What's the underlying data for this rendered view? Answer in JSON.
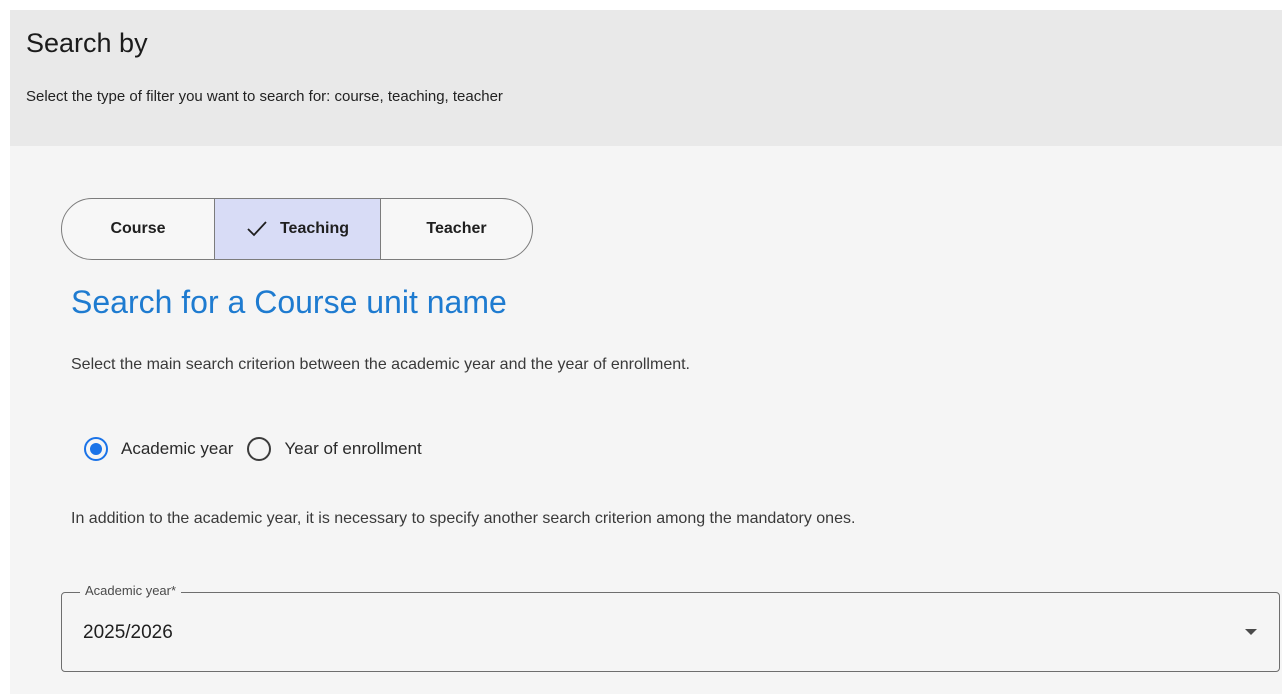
{
  "header": {
    "title": "Search by",
    "subtitle": "Select the type of filter you want to search for: course, teaching, teacher"
  },
  "filter_tabs": {
    "items": [
      {
        "label": "Course",
        "selected": false
      },
      {
        "label": "Teaching",
        "selected": true
      },
      {
        "label": "Teacher",
        "selected": false
      }
    ],
    "selected_icon": "check-icon"
  },
  "main": {
    "title": "Search for a Course unit name",
    "criterion_instruction": "Select the main search criterion between the academic year and the year of enrollment.",
    "criterion_options": [
      {
        "label": "Academic year",
        "checked": true
      },
      {
        "label": "Year of enrollment",
        "checked": false
      }
    ],
    "mandatory_note": "In addition to the academic year, it is necessary to specify another search criterion among the mandatory ones."
  },
  "academic_year_field": {
    "label": "Academic year*",
    "value": "2025/2026",
    "icon": "dropdown-arrow-icon"
  },
  "colors": {
    "accent": "#1a73e8",
    "title_blue": "#1e7bd0",
    "selected_tab_bg": "#d8dcf6",
    "header_bg": "#e9e9e9",
    "body_bg": "#f5f5f5"
  }
}
